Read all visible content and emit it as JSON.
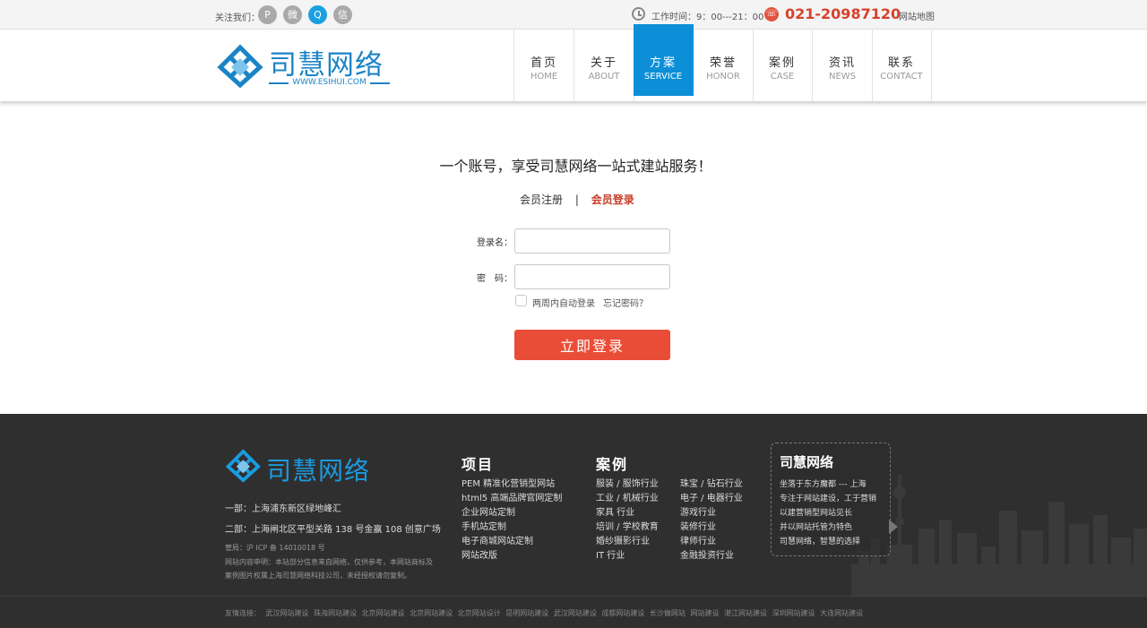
{
  "topbar": {
    "follow_label": "关注我们：",
    "social": [
      {
        "icon": "pinterest-icon",
        "glyph": "P"
      },
      {
        "icon": "weibo-icon",
        "glyph": "微"
      },
      {
        "icon": "qq-icon",
        "glyph": "Q"
      },
      {
        "icon": "wechat-icon",
        "glyph": "信"
      }
    ],
    "worktime": "工作时间：9：00---21：00",
    "phone": "021-20987120",
    "sitemap": "网站地图"
  },
  "header": {
    "logo_text": "司慧网络",
    "logo_url": "WWW.ESIHUI.COM",
    "brand_color": "#1b84c6",
    "nav": [
      {
        "cn": "首页",
        "en": "HOME",
        "active": false
      },
      {
        "cn": "关于",
        "en": "ABOUT",
        "active": false
      },
      {
        "cn": "方案",
        "en": "SERVICE",
        "active": true
      },
      {
        "cn": "荣誉",
        "en": "HONOR",
        "active": false
      },
      {
        "cn": "案例",
        "en": "CASE",
        "active": false
      },
      {
        "cn": "资讯",
        "en": "NEWS",
        "active": false
      },
      {
        "cn": "联系",
        "en": "CONTACT",
        "active": false
      }
    ]
  },
  "main": {
    "slogan": "一个账号，享受司慧网络一站式建站服务！",
    "register_tab": "会员注册",
    "separator": "|",
    "login_tab": "会员登录",
    "username_label": "登录名：",
    "password_label": "密　码：",
    "username_value": "",
    "password_value": "",
    "remember_label": "两周内自动登录",
    "forgot_label": "忘记密码？",
    "submit_label": "立即登录",
    "accent_color": "#ea4d37"
  },
  "footer": {
    "logo_text": "司慧网络",
    "address1": "一部：上海浦东新区绿地峰汇",
    "address2": "二部：上海闸北区平型关路 138 号金赢 108 创意广场",
    "icp": "管局：沪 ICP 备 14010018 号",
    "notice": "网站内容申明：本站部分信息来自网络，仅供参考，本网站商标及案例图片权属上海司慧网络科技公司，未经授权请勿复制。",
    "projects_title": "项目",
    "projects": [
      "PEM 精准化营销型网站",
      "html5 高端品牌官网定制",
      "企业网站定制",
      "手机站定制",
      "电子商城网站定制",
      "网站改版"
    ],
    "cases_title": "案例",
    "cases_col1": [
      "服装 / 服饰行业",
      "工业 / 机械行业",
      "家具 行业",
      "培训 / 学校教育",
      "婚纱摄影行业",
      "IT 行业"
    ],
    "cases_col2": [
      "珠宝 / 钻石行业",
      "电子 / 电器行业",
      "游戏行业",
      "装修行业",
      "律师行业",
      "金融投资行业"
    ],
    "about_title": "司慧网络",
    "about_lines": [
      "坐落于东方魔都 --- 上海",
      "专注于网站建设，工于营销",
      "以建营销型网站见长",
      "并以网站托管为特色",
      "司慧网络，智慧的选择"
    ],
    "friends_label": "友情连接：",
    "friends": [
      "武汉网站建设",
      "珠海网站建设",
      "北京网站建设",
      "北京网站建设",
      "北京网站设计",
      "昆明网站建设",
      "武汉网站建设",
      "成都网站建设",
      "长沙做网站",
      "网站建设",
      "湛江网站建设",
      "深圳网站建设",
      "大连网站建设"
    ]
  }
}
